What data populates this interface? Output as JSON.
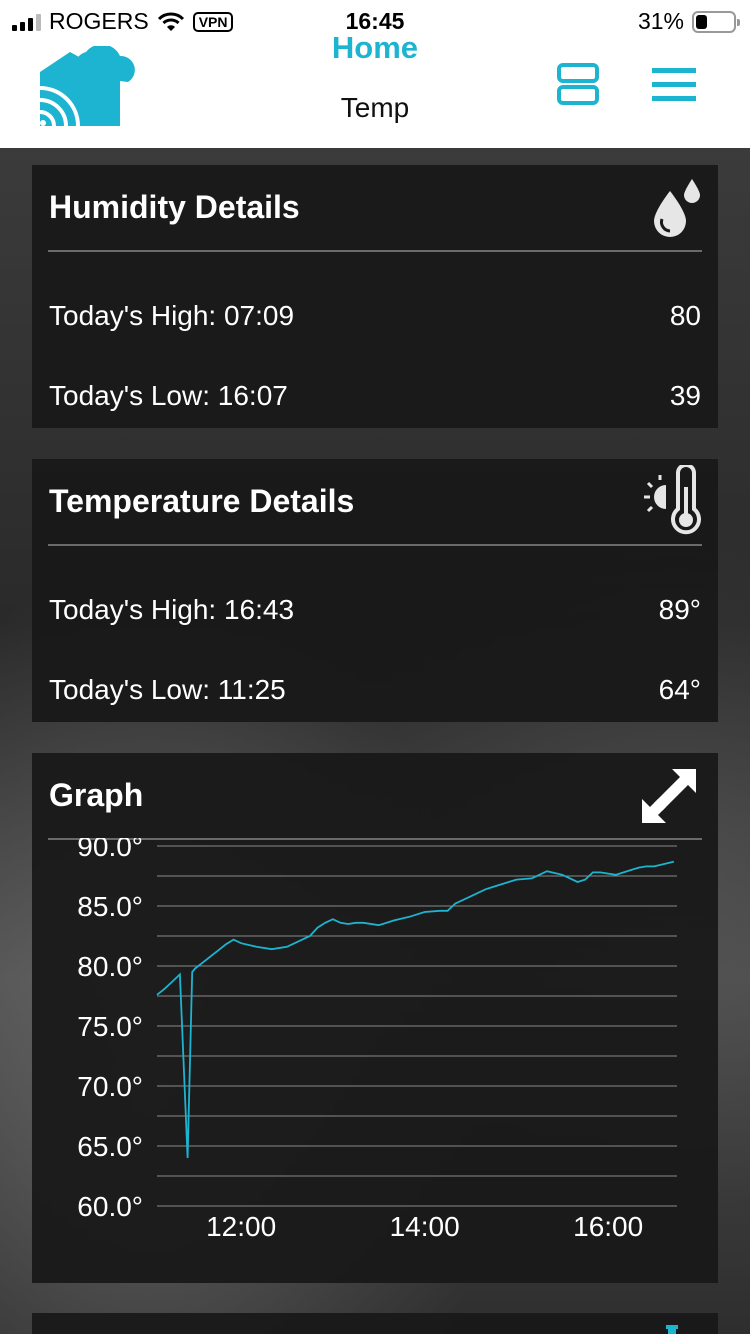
{
  "status_bar": {
    "carrier": "ROGERS",
    "vpn": "VPN",
    "time": "16:45",
    "battery": "31%",
    "battery_level": 0.31
  },
  "header": {
    "title": "Home",
    "subtitle": "Temp",
    "accent_color": "#1cb4d0"
  },
  "humidity": {
    "title": "Humidity Details",
    "icon": "water-drops-icon",
    "rows": [
      {
        "label": "Today's High: 07:09",
        "value": "80"
      },
      {
        "label": "Today's Low: 16:07",
        "value": "39"
      }
    ]
  },
  "temperature": {
    "title": "Temperature Details",
    "icon": "thermometer-sun-icon",
    "rows": [
      {
        "label": "Today's High: 16:43",
        "value": "89°"
      },
      {
        "label": "Today's Low: 11:25",
        "value": "64°"
      }
    ]
  },
  "graph": {
    "title": "Graph",
    "icon": "expand-arrows-icon"
  },
  "chart_data": {
    "type": "line",
    "title": "",
    "xlabel": "",
    "ylabel": "",
    "x_ticks": [
      "12:00",
      "14:00",
      "16:00"
    ],
    "y_ticks": [
      "90.0°",
      "85.0°",
      "80.0°",
      "75.0°",
      "70.0°",
      "65.0°",
      "60.0°"
    ],
    "ylim": [
      60,
      90
    ],
    "xlim": [
      "11:05",
      "16:45"
    ],
    "grid": true,
    "line_color": "#1cb4d0",
    "series": [
      {
        "x": [
          "11:05",
          "11:10",
          "11:15",
          "11:20",
          "11:25",
          "11:28",
          "11:30",
          "11:35",
          "11:40",
          "11:45",
          "11:50",
          "11:55",
          "12:00",
          "12:10",
          "12:20",
          "12:30",
          "12:40",
          "12:45",
          "12:50",
          "12:55",
          "13:00",
          "13:05",
          "13:10",
          "13:15",
          "13:20",
          "13:30",
          "13:40",
          "13:50",
          "14:00",
          "14:10",
          "14:15",
          "14:20",
          "14:30",
          "14:40",
          "14:50",
          "15:00",
          "15:10",
          "15:20",
          "15:30",
          "15:40",
          "15:45",
          "15:50",
          "15:55",
          "16:00",
          "16:05",
          "16:10",
          "16:20",
          "16:25",
          "16:30",
          "16:40",
          "16:43"
        ],
        "y": [
          77.6,
          78.1,
          78.7,
          79.3,
          64.0,
          79.5,
          79.8,
          80.3,
          80.8,
          81.3,
          81.8,
          82.2,
          81.9,
          81.6,
          81.4,
          81.6,
          82.2,
          82.5,
          83.2,
          83.6,
          83.9,
          83.6,
          83.5,
          83.6,
          83.6,
          83.4,
          83.8,
          84.1,
          84.5,
          84.6,
          84.6,
          85.2,
          85.8,
          86.4,
          86.8,
          87.2,
          87.3,
          87.9,
          87.6,
          87.0,
          87.2,
          87.8,
          87.8,
          87.7,
          87.6,
          87.8,
          88.2,
          88.3,
          88.3,
          88.6,
          88.7
        ]
      }
    ]
  },
  "next_card": {
    "icon": "partial-icon"
  }
}
